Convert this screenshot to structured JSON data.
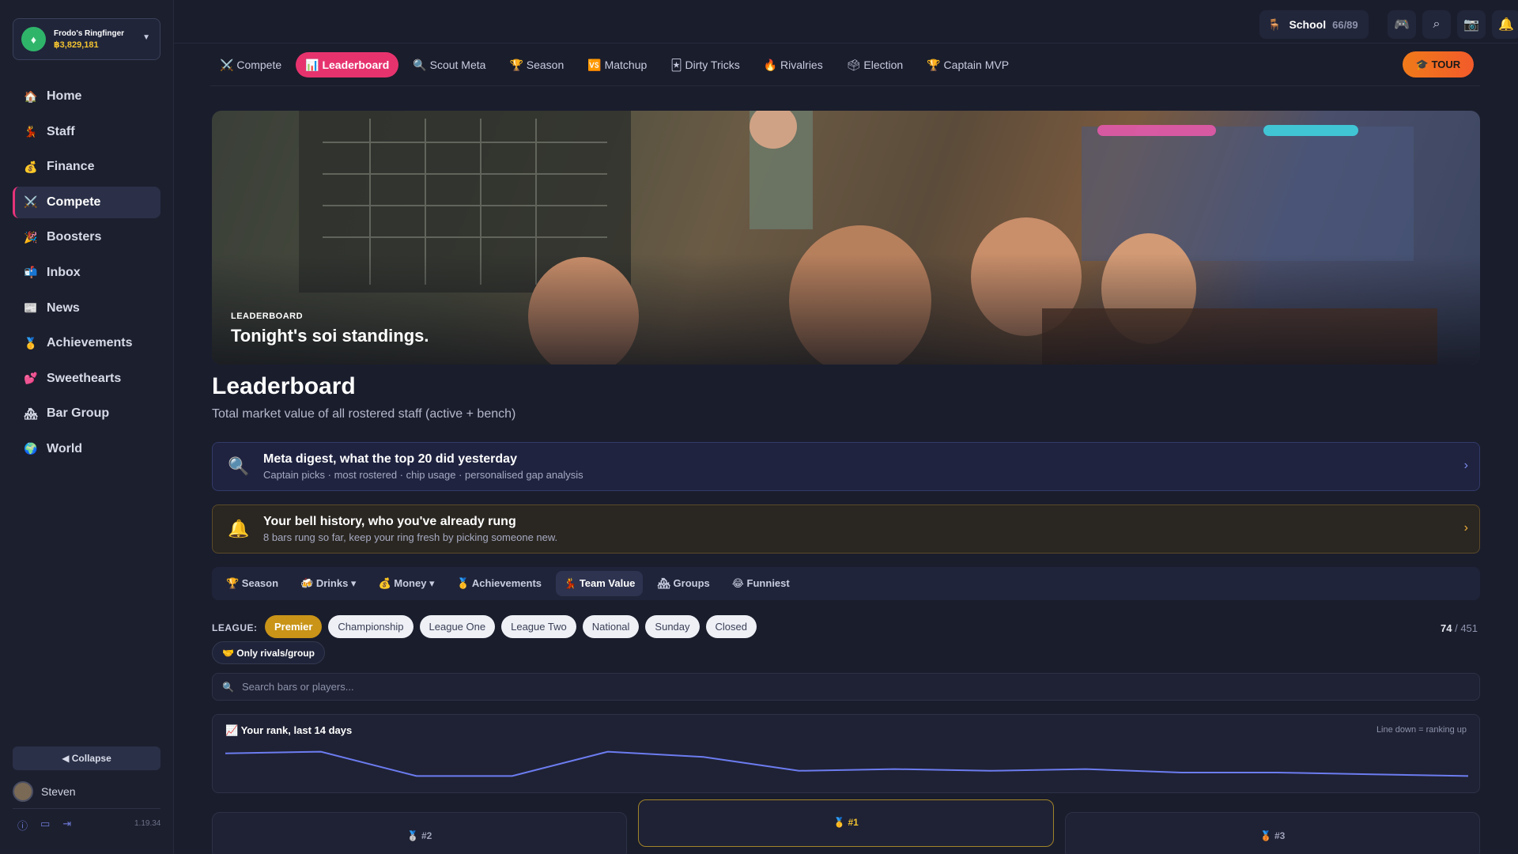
{
  "account": {
    "name": "Frodo's Ringfinger",
    "money": "฿3,829,181"
  },
  "sidebar": {
    "items": [
      {
        "icon": "🏠",
        "label": "Home"
      },
      {
        "icon": "💃",
        "label": "Staff"
      },
      {
        "icon": "💰",
        "label": "Finance"
      },
      {
        "icon": "⚔️",
        "label": "Compete",
        "active": true
      },
      {
        "icon": "🎉",
        "label": "Boosters"
      },
      {
        "icon": "📬",
        "label": "Inbox"
      },
      {
        "icon": "📰",
        "label": "News"
      },
      {
        "icon": "🥇",
        "label": "Achievements"
      },
      {
        "icon": "💕",
        "label": "Sweethearts"
      },
      {
        "icon": "🏘",
        "label": "Bar Group"
      },
      {
        "icon": "🌍",
        "label": "World"
      }
    ],
    "collapse_label": "◀ Collapse",
    "user_name": "Steven",
    "version": "1.19.34"
  },
  "topbar": {
    "school_label": "School",
    "school_count": "66/89"
  },
  "tabs": [
    {
      "icon": "⚔️",
      "label": "Compete"
    },
    {
      "icon": "📊",
      "label": "Leaderboard",
      "active": true
    },
    {
      "icon": "🔍",
      "label": "Scout Meta"
    },
    {
      "icon": "🏆",
      "label": "Season"
    },
    {
      "icon": "🆚",
      "label": "Matchup"
    },
    {
      "icon": "🃏",
      "label": "Dirty Tricks"
    },
    {
      "icon": "🔥",
      "label": "Rivalries"
    },
    {
      "icon": "🗳",
      "label": "Election"
    },
    {
      "icon": "🏆",
      "label": "Captain MVP"
    }
  ],
  "tour_label": "🎓 TOUR",
  "hero": {
    "kicker": "LEADERBOARD",
    "title": "Tonight's soi standings."
  },
  "page": {
    "title": "Leaderboard",
    "subtitle": "Total market value of all rostered staff (active + bench)"
  },
  "banners": {
    "meta": {
      "title": "Meta digest, what the top 20 did yesterday",
      "sub": "Captain picks · most rostered · chip usage · personalised gap analysis"
    },
    "bell": {
      "title": "Your bell history, who you've already rung",
      "sub": "8 bars rung so far, keep your ring fresh by picking someone new."
    }
  },
  "categories": [
    {
      "label": "🏆 Season"
    },
    {
      "label": "🍻 Drinks ▾"
    },
    {
      "label": "💰 Money ▾"
    },
    {
      "label": "🥇 Achievements"
    },
    {
      "label": "💃 Team Value",
      "active": true
    },
    {
      "label": "🏘 Groups"
    },
    {
      "label": "😂 Funniest"
    }
  ],
  "league": {
    "label": "LEAGUE:",
    "options": [
      "Premier",
      "Championship",
      "League One",
      "League Two",
      "National",
      "Sunday",
      "Closed"
    ],
    "selected": "Premier",
    "count_shown": "74",
    "count_total": "/ 451",
    "rivals_toggle": "🤝 Only rivals/group"
  },
  "search": {
    "placeholder": "Search bars or players..."
  },
  "rank_chart": {
    "title": "📈 Your rank, last 14 days",
    "note": "Line down = ranking up"
  },
  "chart_data": {
    "type": "line",
    "title": "📈 Your rank, last 14 days",
    "series": [
      {
        "values": [
          24,
          23,
          37,
          37,
          23,
          26,
          34,
          33,
          34,
          33,
          35,
          35,
          36,
          37
        ]
      }
    ],
    "ylim": [
      20,
      40
    ],
    "grid": false,
    "color": "#6c7cf0"
  },
  "podium": [
    {
      "label": "🥈 #2"
    },
    {
      "label": "🥇 #1"
    },
    {
      "label": "🥉 #3"
    }
  ],
  "colors": {
    "accent": "#e6336e",
    "gold": "#c99418",
    "line": "#6c7cf0"
  }
}
